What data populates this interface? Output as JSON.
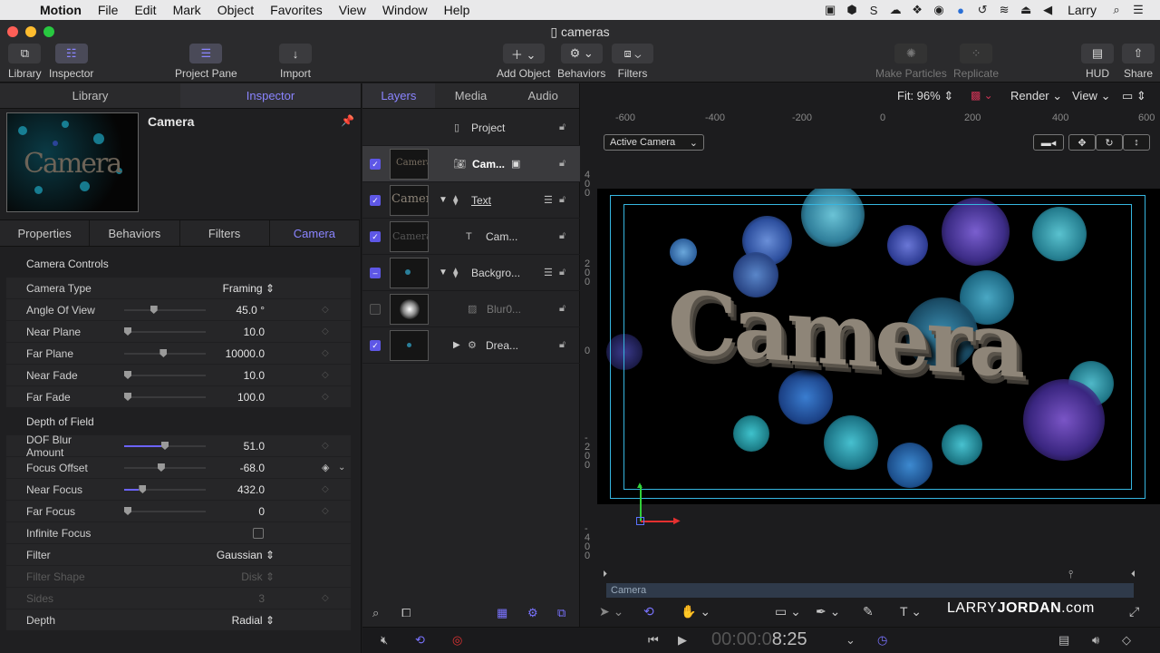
{
  "menubar": {
    "app": "Motion",
    "items": [
      "File",
      "Edit",
      "Mark",
      "Object",
      "Favorites",
      "View",
      "Window",
      "Help"
    ],
    "user": "Larry"
  },
  "window": {
    "title": "cameras"
  },
  "toolbar": {
    "library": "Library",
    "inspector": "Inspector",
    "project_pane": "Project Pane",
    "import": "Import",
    "add_object": "Add Object",
    "behaviors": "Behaviors",
    "filters": "Filters",
    "make_particles": "Make Particles",
    "replicate": "Replicate",
    "hud": "HUD",
    "share": "Share"
  },
  "left": {
    "tabs": [
      "Library",
      "Inspector"
    ],
    "preview_text": "Camera",
    "title": "Camera",
    "subtabs": [
      "Properties",
      "Behaviors",
      "Filters",
      "Camera"
    ],
    "camera_controls": {
      "heading": "Camera Controls",
      "camera_type": {
        "label": "Camera Type",
        "value": "Framing"
      },
      "angle_of_view": {
        "label": "Angle Of View",
        "value": "45.0",
        "unit": "°",
        "level": 0.35
      },
      "near_plane": {
        "label": "Near Plane",
        "value": "10.0",
        "level": 0.0
      },
      "far_plane": {
        "label": "Far Plane",
        "value": "10000.0",
        "level": 0.48
      },
      "near_fade": {
        "label": "Near Fade",
        "value": "10.0",
        "level": 0.0
      },
      "far_fade": {
        "label": "Far Fade",
        "value": "100.0",
        "level": 0.0
      }
    },
    "dof": {
      "heading": "Depth of Field",
      "blur": {
        "label": "DOF Blur Amount",
        "value": "51.0",
        "level": 0.5
      },
      "focus_offset": {
        "label": "Focus Offset",
        "value": "-68.0",
        "level": 0.45
      },
      "near_focus": {
        "label": "Near Focus",
        "value": "432.0",
        "level": 0.2
      },
      "far_focus": {
        "label": "Far Focus",
        "value": "0",
        "level": 0.0
      },
      "infinite_focus": {
        "label": "Infinite Focus",
        "checked": false
      },
      "filter": {
        "label": "Filter",
        "value": "Gaussian"
      },
      "filter_shape": {
        "label": "Filter Shape",
        "value": "Disk"
      },
      "sides": {
        "label": "Sides",
        "value": "3"
      },
      "depth": {
        "label": "Depth",
        "value": "Radial"
      }
    }
  },
  "layers": {
    "tabs": [
      "Layers",
      "Media",
      "Audio"
    ],
    "project": "Project",
    "rows": [
      {
        "name": "Cam...",
        "checked": true
      },
      {
        "name": "Text",
        "checked": true
      },
      {
        "name": "Cam...",
        "checked": true
      },
      {
        "name": "Backgro...",
        "checked": "mixed"
      },
      {
        "name": "Blur0...",
        "checked": false
      },
      {
        "name": "Drea...",
        "checked": true
      }
    ]
  },
  "canvas": {
    "fit": "Fit: 96%",
    "render": "Render",
    "view": "View",
    "camera_select": "Active Camera",
    "ruler_h": [
      "-600",
      "-400",
      "-200",
      "0",
      "200",
      "400",
      "600"
    ],
    "ruler_v": [
      "400",
      "200",
      "0",
      "-200",
      "-400"
    ],
    "stage_text": "Camera",
    "timeline_label": "Camera",
    "watermark_a": "LARRY",
    "watermark_b": "JORDAN",
    "watermark_c": ".com"
  },
  "transport": {
    "timecode_dim": "00:00:0",
    "timecode": "8:25"
  },
  "colors": {
    "accent": "#6b63ff",
    "frame": "#36b6e0"
  }
}
